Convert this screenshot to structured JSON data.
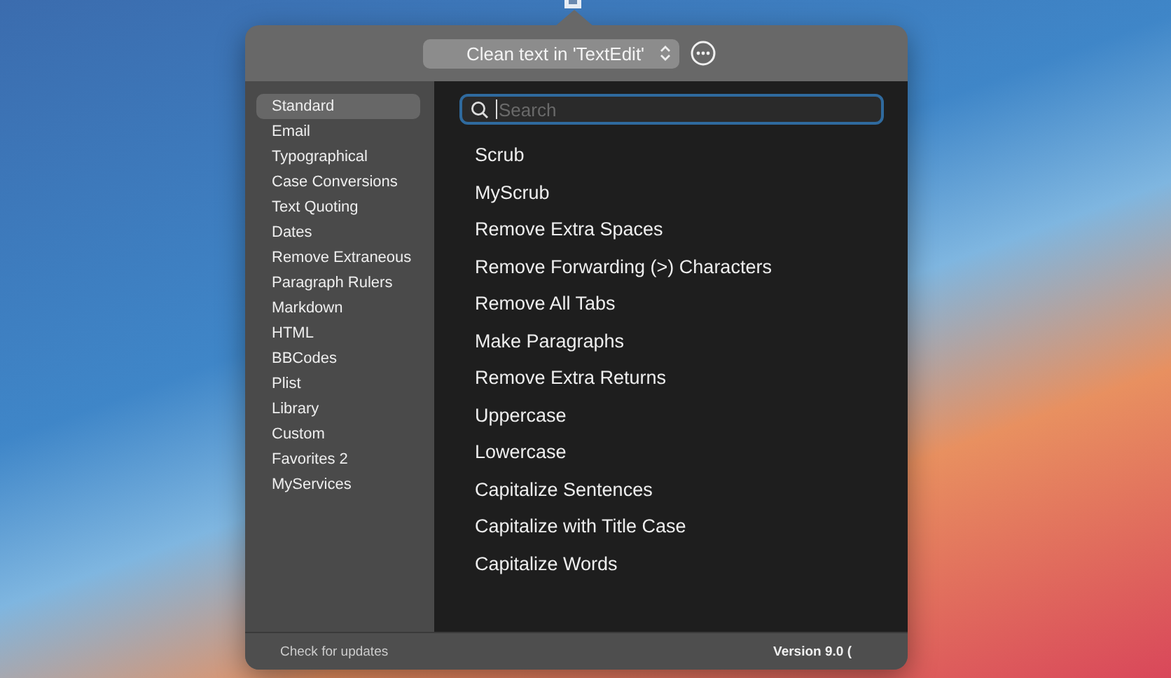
{
  "popover": {
    "action_menu": "Clean text in 'TextEdit'"
  },
  "sidebar": {
    "items": [
      {
        "label": "Standard",
        "selected": true
      },
      {
        "label": "Email",
        "selected": false
      },
      {
        "label": "Typographical",
        "selected": false
      },
      {
        "label": "Case Conversions",
        "selected": false
      },
      {
        "label": "Text Quoting",
        "selected": false
      },
      {
        "label": "Dates",
        "selected": false
      },
      {
        "label": "Remove Extraneous",
        "selected": false
      },
      {
        "label": "Paragraph Rulers",
        "selected": false
      },
      {
        "label": "Markdown",
        "selected": false
      },
      {
        "label": "HTML",
        "selected": false
      },
      {
        "label": "BBCodes",
        "selected": false
      },
      {
        "label": "Plist",
        "selected": false
      },
      {
        "label": "Library",
        "selected": false
      },
      {
        "label": "Custom",
        "selected": false
      },
      {
        "label": "Favorites 2",
        "selected": false
      },
      {
        "label": "MyServices",
        "selected": false
      }
    ]
  },
  "search": {
    "placeholder": "Search"
  },
  "actions": [
    "Scrub",
    "MyScrub",
    "Remove Extra Spaces",
    "Remove Forwarding (>) Characters",
    "Remove All Tabs",
    "Make Paragraphs",
    "Remove Extra Returns",
    "Uppercase",
    "Lowercase",
    "Capitalize Sentences",
    "Capitalize with Title Case",
    "Capitalize Words"
  ],
  "footer": {
    "update_link": "Check for updates",
    "version": "Version 9.0 ("
  }
}
